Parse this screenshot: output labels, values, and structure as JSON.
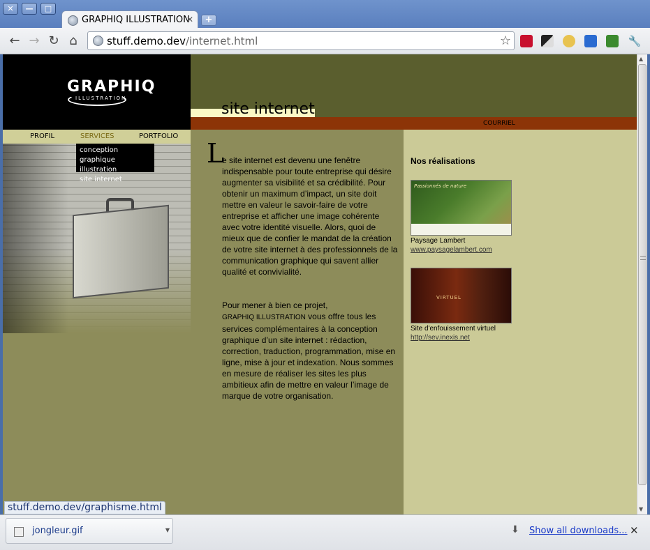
{
  "window": {
    "minimize": "—",
    "maximize": "□",
    "close": "✕"
  },
  "tab": {
    "title": "GRAPHIQ ILLUSTRATION",
    "close": "✕",
    "new_tab": "+"
  },
  "toolbar": {
    "back": "←",
    "forward": "→",
    "reload": "↻",
    "home": "⌂",
    "star": "☆",
    "wrench": "🔧"
  },
  "omnibox": {
    "host": "stuff.demo.dev",
    "path": "/internet.html"
  },
  "site": {
    "logo": "GRAPHIQ",
    "logo_sub": "ILLUSTRATION",
    "page_title": "site internet",
    "courriel": "COURRIEL",
    "nav": {
      "profil": "PROFIL",
      "services": "SERVICES",
      "portfolio": "PORTFOLIO"
    },
    "dropdown": [
      "conception graphique",
      "illustration",
      "site internet"
    ],
    "dropcap": "L",
    "para1": "e site internet est devenu une fenêtre indispensable pour toute entreprise qui désire augmenter sa visibilité et sa crédibilité. Pour obtenir un maximum d’impact, un site doit mettre en valeur le savoir-faire de votre entreprise et afficher une image cohérente avec votre identité visuelle. Alors, quoi de mieux que de confier le mandat de la création de votre site internet à des professionnels de la communication graphique qui savent allier qualité et convivialité.",
    "para2_start": "Pour mener à bien ce projet,",
    "para2_brand": "GRAPHIQ ILLUSTRATION",
    "para2_rest": " vous offre tous les services complémentaires à la conception graphique d’un site internet : rédaction, correction, traduction, programmation, mise en ligne, mise à jour et indexation. Nous sommes en mesure de réaliser les sites les plus ambitieux afin de mettre en valeur l’image de marque de votre organisation.",
    "realisations_title": "Nos réalisations",
    "work1": {
      "thumb_text": "Passionnés de nature",
      "caption": "Paysage Lambert",
      "link": "www.paysagelambert.com"
    },
    "work2": {
      "thumb_text": "VIRTUEL",
      "caption": "Site d'enfouissement virtuel",
      "link": "http://sev.inexis.net"
    }
  },
  "status_url": "stuff.demo.dev/graphisme.html",
  "downloads": {
    "file": "jongleur.gif",
    "show_all": "Show all downloads...",
    "close": "✕"
  }
}
